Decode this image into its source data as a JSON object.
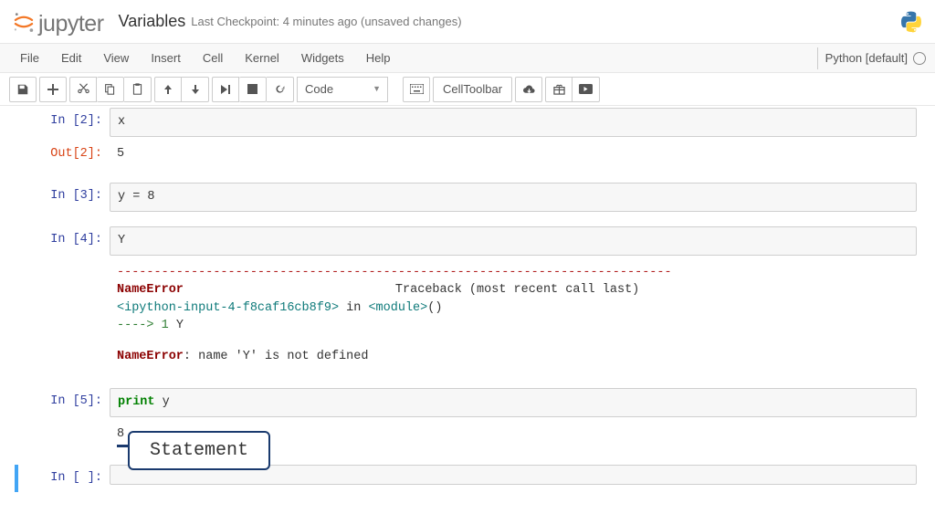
{
  "header": {
    "logo_text": "jupyter",
    "title": "Variables",
    "checkpoint": "Last Checkpoint: 4 minutes ago (unsaved changes)"
  },
  "menubar": [
    "File",
    "Edit",
    "View",
    "Insert",
    "Cell",
    "Kernel",
    "Widgets",
    "Help"
  ],
  "kernel_indicator": "Python [default]",
  "toolbar": {
    "celltype": "Code",
    "celltoolbar": "CellToolbar"
  },
  "cells": {
    "c1": {
      "prompt": "In [2]:",
      "code": "x"
    },
    "c1out": {
      "prompt": "Out[2]:",
      "text": "5"
    },
    "c2": {
      "prompt": "In [3]:",
      "code": "y = 8"
    },
    "c3": {
      "prompt": "In [4]:",
      "code": "Y"
    },
    "c3err": {
      "sep": "---------------------------------------------------------------------------",
      "name1": "NameError",
      "trace_hdr": "Traceback (most recent call last)",
      "ipy": "<ipython-input-4-f8caf16cb8f9>",
      "in_txt": " in ",
      "mod": "<module>",
      "paren": "()",
      "arrow": "----> 1 ",
      "arrow_code": "Y",
      "final": "NameError",
      "final_msg": ": name 'Y' is not defined"
    },
    "c4": {
      "prompt": "In [5]:",
      "kw": "print",
      "rest": " y",
      "out": "8"
    },
    "c5": {
      "prompt": "In [ ]:"
    }
  },
  "annotation": "Statement"
}
